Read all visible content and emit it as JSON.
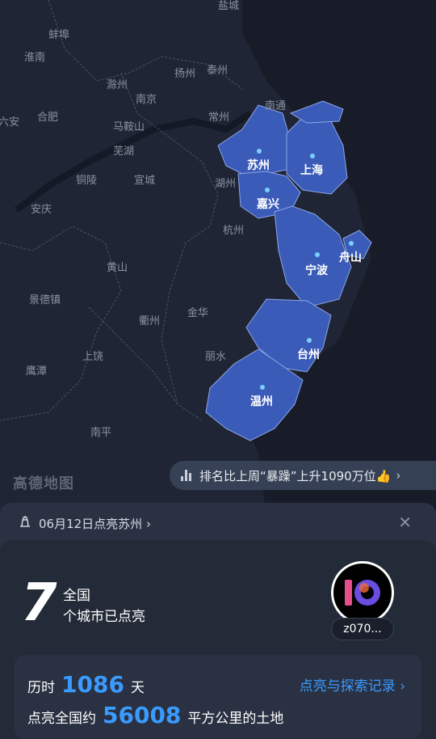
{
  "map": {
    "watermark": "高德地图",
    "cities": [
      {
        "name": "盐城"
      },
      {
        "name": "蚌埠"
      },
      {
        "name": "淮南"
      },
      {
        "name": "滁州"
      },
      {
        "name": "扬州"
      },
      {
        "name": "泰州"
      },
      {
        "name": "南京"
      },
      {
        "name": "南通"
      },
      {
        "name": "六安"
      },
      {
        "name": "合肥"
      },
      {
        "name": "马鞍山"
      },
      {
        "name": "常州"
      },
      {
        "name": "芜湖"
      },
      {
        "name": "铜陵"
      },
      {
        "name": "宣城"
      },
      {
        "name": "湖州"
      },
      {
        "name": "安庆"
      },
      {
        "name": "杭州"
      },
      {
        "name": "黄山"
      },
      {
        "name": "景德镇"
      },
      {
        "name": "衢州"
      },
      {
        "name": "金华"
      },
      {
        "name": "上饶"
      },
      {
        "name": "丽水"
      },
      {
        "name": "鹰潭"
      },
      {
        "name": "南平"
      }
    ],
    "highlighted": [
      {
        "name": "苏州"
      },
      {
        "name": "上海"
      },
      {
        "name": "嘉兴"
      },
      {
        "name": "舟山"
      },
      {
        "name": "宁波"
      },
      {
        "name": "台州"
      },
      {
        "name": "温州"
      }
    ]
  },
  "rank_banner": {
    "text": "排名比上周“暴躁”上升1090万位👍"
  },
  "notice": {
    "text": "06月12日点亮苏州 ›",
    "close": "✕"
  },
  "summary": {
    "count": "7",
    "label1": "全国",
    "label2": "个城市已点亮",
    "username": "z070..."
  },
  "stats": {
    "prefix1": "历时",
    "days": "1086",
    "suffix1": "天",
    "prefix2": "点亮全国约",
    "area": "56008",
    "suffix2": "平方公里的土地",
    "link": "点亮与探索记录 ›"
  },
  "colors": {
    "accent": "#3a9bff",
    "highlight_fill": "#3a5cb8",
    "background": "#1e2433"
  }
}
